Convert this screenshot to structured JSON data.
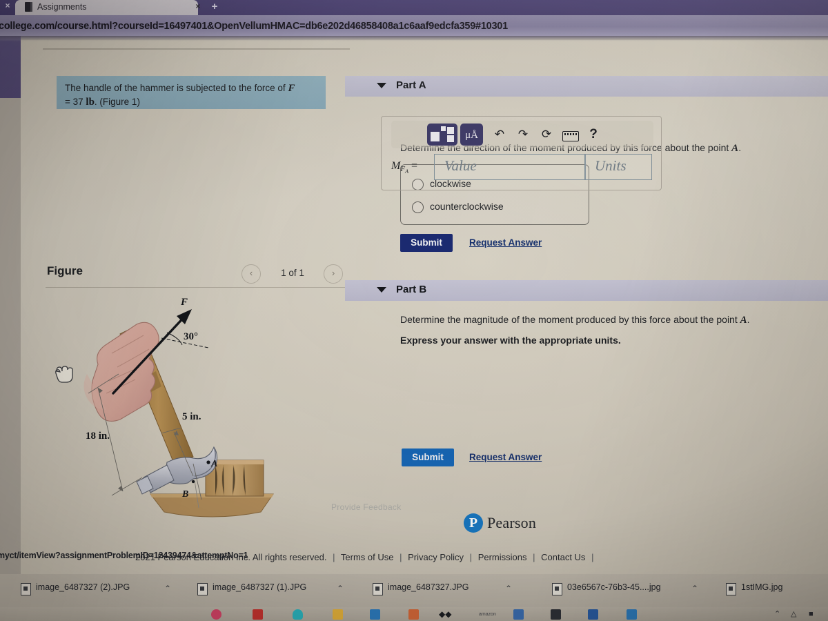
{
  "browser": {
    "tab_title": "Assignments",
    "tab_close": "×",
    "left_close": "×",
    "new_tab": "+",
    "url": "college.com/course.html?courseId=16497401&OpenVellumHMAC=db6e202d46858408a1c6aaf9edcfa359#10301",
    "status_url": "myct/itemView?assignmentProblemID=12439474&attemptNo=1"
  },
  "problem": {
    "text_before": "The handle of the hammer is subjected to the force of ",
    "force_symbol": "F",
    "text_equals": "= 37 ",
    "force_units": "lb",
    "figure_ref": ". (Figure 1)"
  },
  "figure": {
    "title": "Figure",
    "prev_icon": "‹",
    "next_icon": "›",
    "counter": "1 of 1",
    "labels": {
      "force": "F",
      "angle": "30°",
      "dim_short": "5 in.",
      "dim_long": "18 in.",
      "point_a": "A",
      "point_b": "B"
    }
  },
  "part_a": {
    "caret": "▼",
    "title": "Part A",
    "question_before": "Determine the direction of the moment produced by this force about the point ",
    "question_point": "A",
    "question_after": ".",
    "options": [
      {
        "label": "clockwise",
        "selected": false
      },
      {
        "label": "counterclockwise",
        "selected": false
      }
    ],
    "submit_label": "Submit",
    "request_answer_label": "Request Answer"
  },
  "part_b": {
    "caret": "▼",
    "title": "Part B",
    "question_before": "Determine the magnitude of the moment produced by this force about the point ",
    "question_point": "A",
    "question_after": ".",
    "instruction": "Express your answer with the appropriate units.",
    "toolbar": {
      "template_icon": "template-icon",
      "units_label": "μÅ",
      "undo_icon": "↶",
      "redo_icon": "↷",
      "reset_icon": "⟳",
      "keyboard_icon": "keyboard-icon",
      "help_icon": "?"
    },
    "answer_label_m": "M",
    "answer_label_sub": "F",
    "answer_label_subsub": "A",
    "answer_equals": "=",
    "value_placeholder": "Value",
    "units_placeholder": "Units",
    "value": "",
    "units": "",
    "submit_label": "Submit",
    "request_answer_label": "Request Answer"
  },
  "footer": {
    "feedback_label": "Provide Feedback",
    "pearson_mark": "P",
    "pearson_name": "Pearson",
    "copyright": "2021 Pearson Education Inc. All rights reserved.",
    "links": [
      "Terms of Use",
      "Privacy Policy",
      "Permissions",
      "Contact Us"
    ],
    "separator": "|"
  },
  "downloads": {
    "caret": "⌃",
    "items": [
      {
        "name": "image_6487327 (2).JPG"
      },
      {
        "name": "image_6487327 (1).JPG"
      },
      {
        "name": "image_6487327.JPG"
      },
      {
        "name": "03e6567c-76b3-45....jpg"
      },
      {
        "name": "1stIMG.jpg"
      }
    ]
  },
  "taskbar": {
    "tray_up": "⌃",
    "tray_cloud": "△",
    "tray_box": "■"
  },
  "colors": {
    "statement_bg": "#8fafbd",
    "part_header_bg": "#c0bfd1",
    "submit_a": "#1b2a72",
    "submit_b": "#1767b8",
    "link": "#16306e",
    "pearson_blue": "#1878c4",
    "page_bg": "#d3cdc0",
    "chrome_purple": "#4a4074"
  }
}
